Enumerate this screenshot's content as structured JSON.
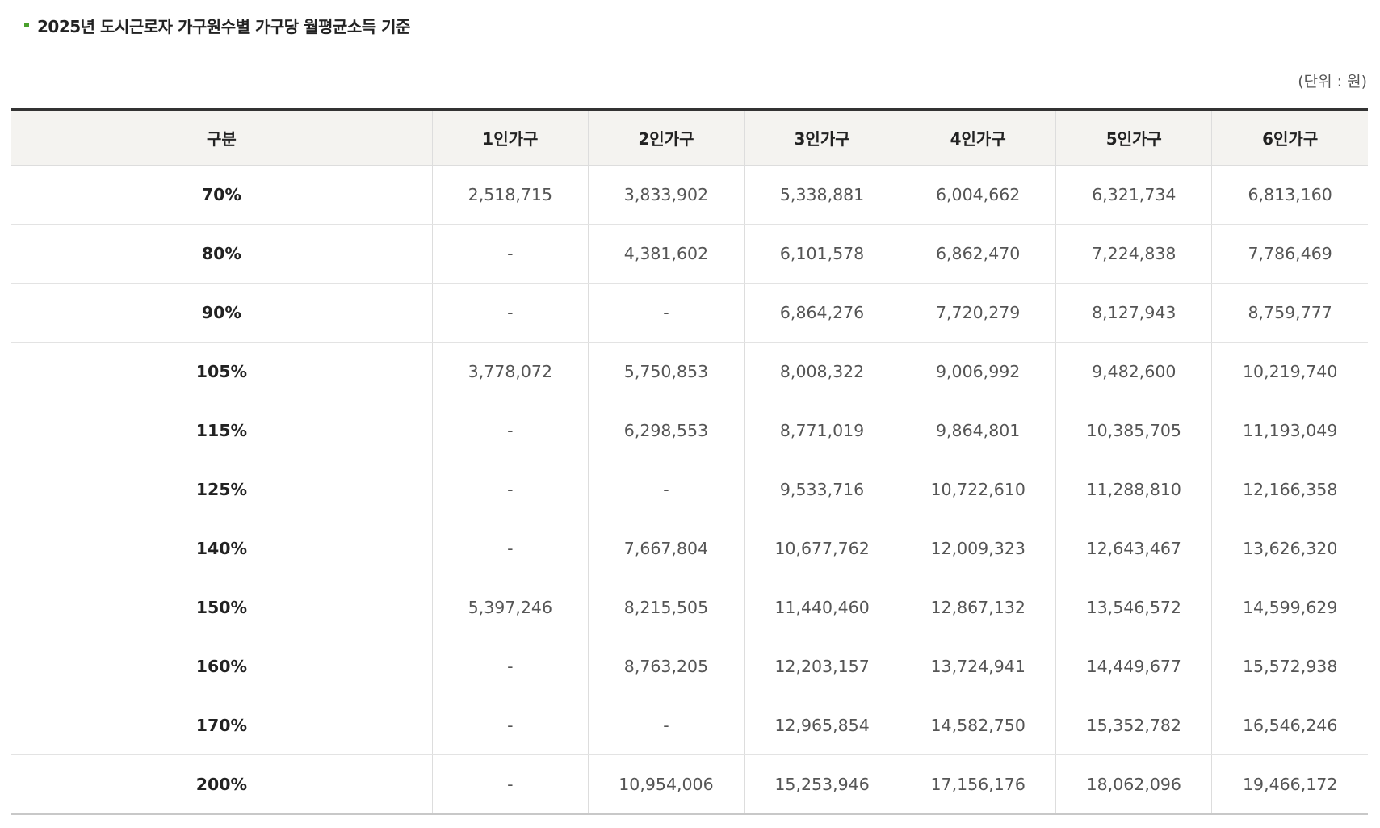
{
  "heading": {
    "title": "2025년 도시근로자 가구원수별 가구당 월평균소득 기준",
    "unit": "(단위 : 원)"
  },
  "table": {
    "headers": [
      "구분",
      "1인가구",
      "2인가구",
      "3인가구",
      "4인가구",
      "5인가구",
      "6인가구"
    ],
    "rows": [
      [
        "70%",
        "2,518,715",
        "3,833,902",
        "5,338,881",
        "6,004,662",
        "6,321,734",
        "6,813,160"
      ],
      [
        "80%",
        "-",
        "4,381,602",
        "6,101,578",
        "6,862,470",
        "7,224,838",
        "7,786,469"
      ],
      [
        "90%",
        "-",
        "-",
        "6,864,276",
        "7,720,279",
        "8,127,943",
        "8,759,777"
      ],
      [
        "105%",
        "3,778,072",
        "5,750,853",
        "8,008,322",
        "9,006,992",
        "9,482,600",
        "10,219,740"
      ],
      [
        "115%",
        "-",
        "6,298,553",
        "8,771,019",
        "9,864,801",
        "10,385,705",
        "11,193,049"
      ],
      [
        "125%",
        "-",
        "-",
        "9,533,716",
        "10,722,610",
        "11,288,810",
        "12,166,358"
      ],
      [
        "140%",
        "-",
        "7,667,804",
        "10,677,762",
        "12,009,323",
        "12,643,467",
        "13,626,320"
      ],
      [
        "150%",
        "5,397,246",
        "8,215,505",
        "11,440,460",
        "12,867,132",
        "13,546,572",
        "14,599,629"
      ],
      [
        "160%",
        "-",
        "8,763,205",
        "12,203,157",
        "13,724,941",
        "14,449,677",
        "15,572,938"
      ],
      [
        "170%",
        "-",
        "-",
        "12,965,854",
        "14,582,750",
        "15,352,782",
        "16,546,246"
      ],
      [
        "200%",
        "-",
        "10,954,006",
        "15,253,946",
        "17,156,176",
        "18,062,096",
        "19,466,172"
      ]
    ]
  },
  "colors": {
    "bullet": "#4aa02c",
    "header_bg": "#f4f3f0",
    "top_rule": "#333333"
  }
}
